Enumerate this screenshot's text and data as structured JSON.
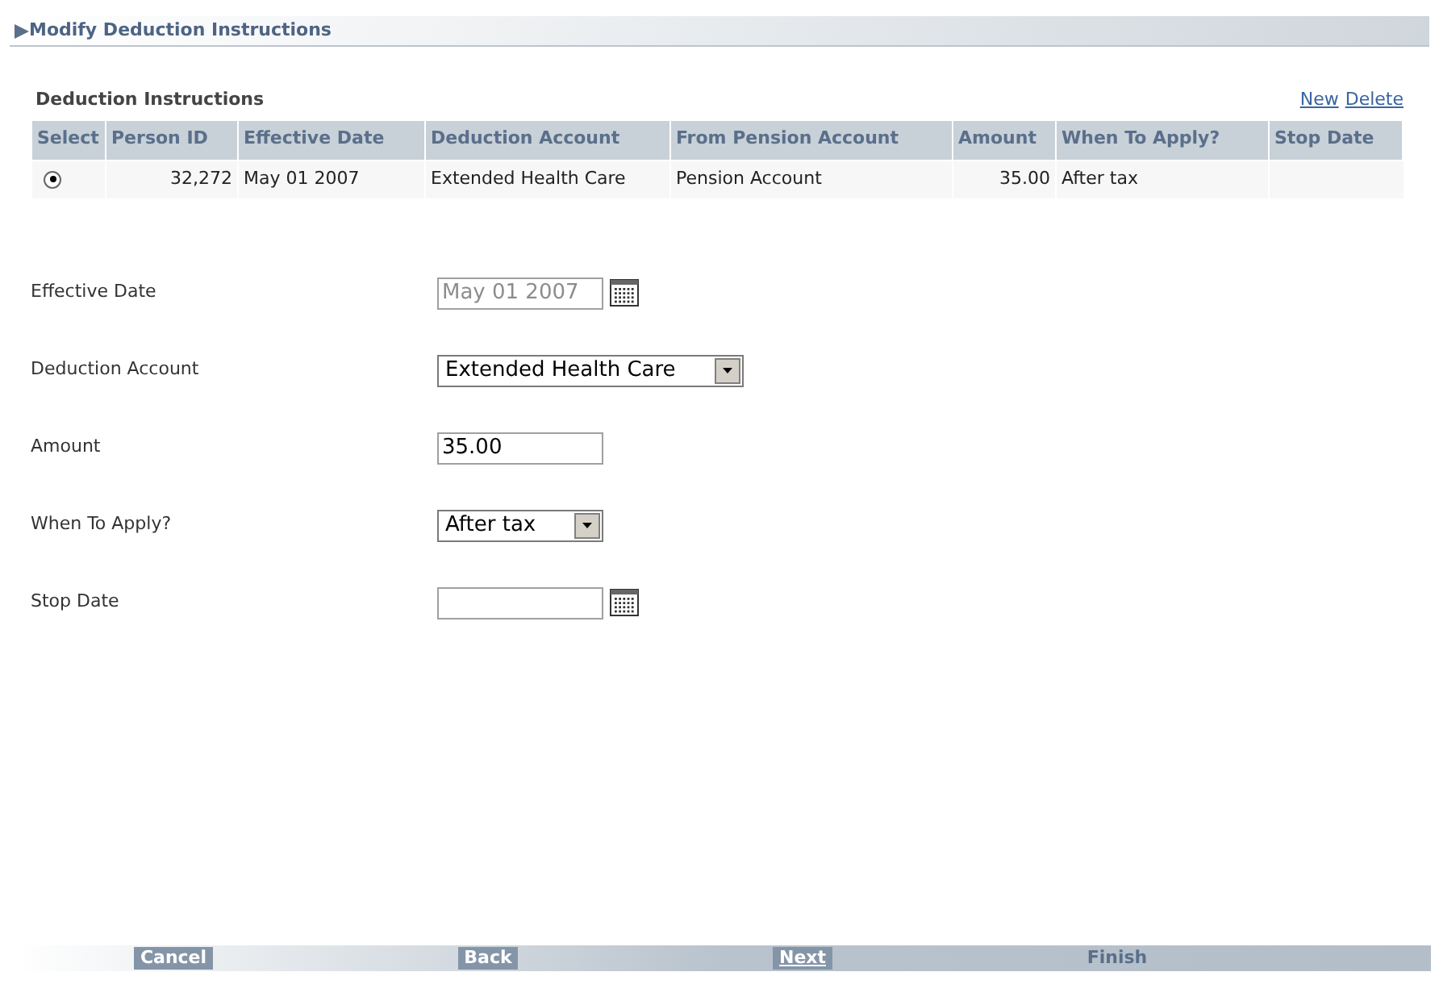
{
  "title": "Modify Deduction Instructions",
  "table": {
    "title": "Deduction Instructions",
    "links": [
      "New",
      "Delete"
    ],
    "columns": [
      "Select",
      "Person ID",
      "Effective Date",
      "Deduction Account",
      "From Pension Account",
      "Amount",
      "When To Apply?",
      "Stop Date"
    ],
    "rows": [
      {
        "selected": true,
        "person_id": "32,272",
        "effective_date": "May 01 2007",
        "deduction_account": "Extended Health Care",
        "from_pension_account": "Pension Account",
        "amount": "35.00",
        "when_to_apply": "After tax"
      }
    ]
  },
  "form": [
    {
      "label": "Effective Date",
      "kind": "date",
      "value": "May 01 2007",
      "disabled": true
    },
    {
      "label": "Deduction Account",
      "kind": "select",
      "value": "Extended Health Care"
    },
    {
      "label": "Amount",
      "kind": "text",
      "value": "35.00"
    },
    {
      "label": "When To Apply?",
      "kind": "select",
      "value": "After tax"
    },
    {
      "label": "Stop Date",
      "kind": "date"
    }
  ],
  "buttons": [
    {
      "label": "Cancel",
      "kind": "light",
      "focused": false
    },
    {
      "label": "Back",
      "kind": "light",
      "focused": false
    },
    {
      "label": "Next",
      "kind": "light",
      "focused": true
    },
    {
      "label": "Finish",
      "kind": "dark",
      "focused": false
    }
  ]
}
